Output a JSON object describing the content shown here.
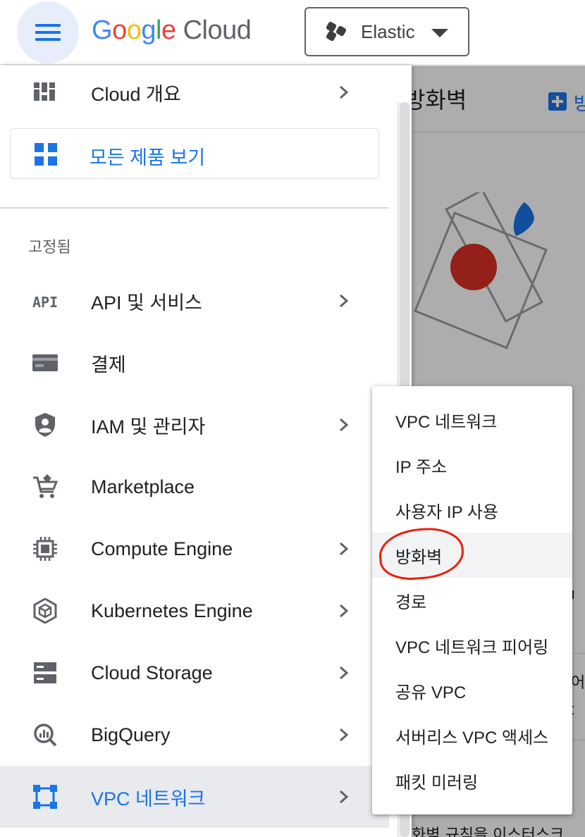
{
  "topbar": {
    "logo_google": [
      "G",
      "o",
      "o",
      "g",
      "l",
      "e"
    ],
    "logo_cloud": "Cloud",
    "project_name": "Elastic"
  },
  "background_page": {
    "title": "방화벽",
    "create_label": "방",
    "text1": "u",
    "text2": "어",
    "text3": "t",
    "bottom_text": "화벽 규칙을 이스터스크"
  },
  "drawer": {
    "overview": {
      "label": "Cloud 개요",
      "icon": "dashboard-icon"
    },
    "all_products": {
      "label": "모든 제품 보기",
      "icon": "grid-icon"
    },
    "pinned_label": "고정됨",
    "items": [
      {
        "label": "API 및 서비스",
        "icon": "api-icon",
        "chevron": true
      },
      {
        "label": "결제",
        "icon": "billing-icon",
        "chevron": false
      },
      {
        "label": "IAM 및 관리자",
        "icon": "shield-person-icon",
        "chevron": true
      },
      {
        "label": "Marketplace",
        "icon": "cart-icon",
        "chevron": false
      },
      {
        "label": "Compute Engine",
        "icon": "chip-icon",
        "chevron": true
      },
      {
        "label": "Kubernetes Engine",
        "icon": "kubernetes-icon",
        "chevron": true
      },
      {
        "label": "Cloud Storage",
        "icon": "storage-icon",
        "chevron": true
      },
      {
        "label": "BigQuery",
        "icon": "bigquery-icon",
        "chevron": true
      },
      {
        "label": "VPC 네트워크",
        "icon": "vpc-icon",
        "chevron": true
      }
    ]
  },
  "flyout": {
    "items": [
      "VPC 네트워크",
      "IP 주소",
      "사용자 IP 사용",
      "방화벽",
      "경로",
      "VPC 네트워크 피어링",
      "공유 VPC",
      "서버리스 VPC 액세스",
      "패킷 미러링"
    ],
    "highlighted": "방화벽"
  },
  "colors": {
    "accent": "#1a73e8",
    "annotation": "#ea1c0a",
    "active_row": "#e8eaed"
  }
}
